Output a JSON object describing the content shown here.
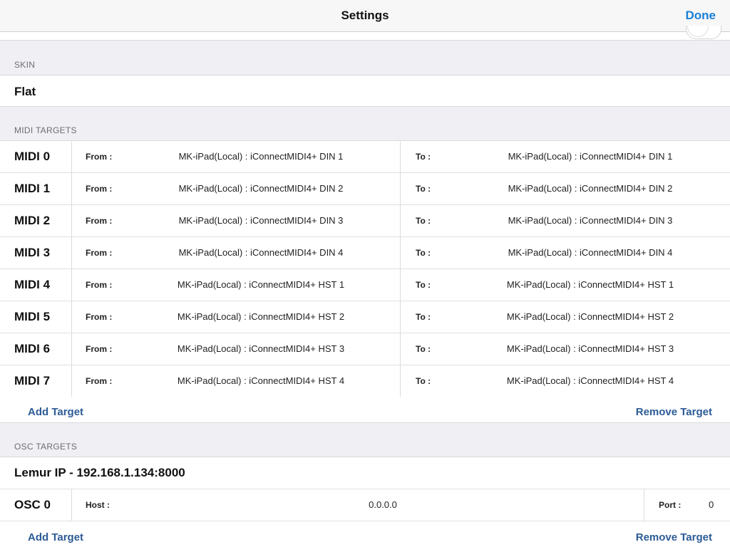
{
  "navbar": {
    "title": "Settings",
    "done_label": "Done"
  },
  "skin": {
    "header": "SKIN",
    "value": "Flat"
  },
  "midi": {
    "header": "MIDI TARGETS",
    "from_label": "From :",
    "to_label": "To :",
    "rows": [
      {
        "name": "MIDI 0",
        "from": "MK-iPad(Local) : iConnectMIDI4+ DIN 1",
        "to": "MK-iPad(Local) : iConnectMIDI4+ DIN 1"
      },
      {
        "name": "MIDI 1",
        "from": "MK-iPad(Local) : iConnectMIDI4+ DIN 2",
        "to": "MK-iPad(Local) : iConnectMIDI4+ DIN 2"
      },
      {
        "name": "MIDI 2",
        "from": "MK-iPad(Local) : iConnectMIDI4+ DIN 3",
        "to": "MK-iPad(Local) : iConnectMIDI4+ DIN 3"
      },
      {
        "name": "MIDI 3",
        "from": "MK-iPad(Local) : iConnectMIDI4+ DIN 4",
        "to": "MK-iPad(Local) : iConnectMIDI4+ DIN 4"
      },
      {
        "name": "MIDI 4",
        "from": "MK-iPad(Local) : iConnectMIDI4+ HST 1",
        "to": "MK-iPad(Local) : iConnectMIDI4+ HST 1"
      },
      {
        "name": "MIDI 5",
        "from": "MK-iPad(Local) : iConnectMIDI4+ HST 2",
        "to": "MK-iPad(Local) : iConnectMIDI4+ HST 2"
      },
      {
        "name": "MIDI 6",
        "from": "MK-iPad(Local) : iConnectMIDI4+ HST 3",
        "to": "MK-iPad(Local) : iConnectMIDI4+ HST 3"
      },
      {
        "name": "MIDI 7",
        "from": "MK-iPad(Local) : iConnectMIDI4+ HST 4",
        "to": "MK-iPad(Local) : iConnectMIDI4+ HST 4"
      }
    ],
    "add_label": "Add Target",
    "remove_label": "Remove Target"
  },
  "osc": {
    "header": "OSC TARGETS",
    "lemur_ip": "Lemur IP - 192.168.1.134:8000",
    "rows": [
      {
        "name": "OSC 0",
        "host_label": "Host :",
        "host": "0.0.0.0",
        "port_label": "Port :",
        "port": "0"
      }
    ],
    "add_label": "Add Target",
    "remove_label": "Remove Target"
  },
  "colors": {
    "accent": "#1a7fd6",
    "action": "#2c5b96",
    "background": "#efeff4"
  }
}
